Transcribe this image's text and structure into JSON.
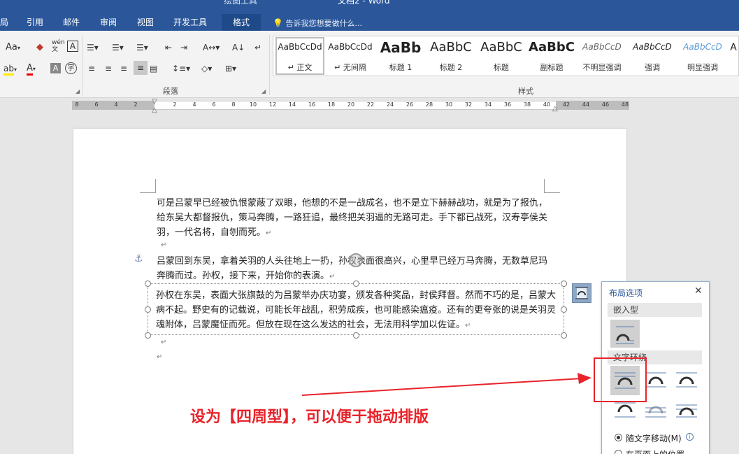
{
  "titlebar": {
    "context_tools": "绘图工具",
    "doc_title": "文档2 - Word",
    "tabs": [
      "局",
      "引用",
      "邮件",
      "审阅",
      "视图",
      "开发工具"
    ],
    "active_tab": "格式",
    "tell_me": "告诉我您想要做什么..."
  },
  "ribbon": {
    "font_case": "Aa",
    "wen": "wén",
    "group_paragraph": "段落",
    "group_styles": "样式",
    "styles": [
      {
        "sample": "AaBbCcDd",
        "name": "↵ 正文",
        "selected": true
      },
      {
        "sample": "AaBbCcDd",
        "name": "↵ 无间隔",
        "selected": false
      },
      {
        "sample": "AaBb",
        "name": "标题 1",
        "selected": false
      },
      {
        "sample": "AaBbC",
        "name": "标题 2",
        "selected": false
      },
      {
        "sample": "AaBbC",
        "name": "标题",
        "selected": false
      },
      {
        "sample": "AaBbC",
        "name": "副标题",
        "selected": false
      },
      {
        "sample": "AaBbCcD",
        "name": "不明显强调",
        "selected": false
      },
      {
        "sample": "AaBbCcD",
        "name": "强调",
        "selected": false
      },
      {
        "sample": "AaBbCcD",
        "name": "明显强调",
        "selected": false
      },
      {
        "sample": "A",
        "name": "",
        "selected": false
      }
    ]
  },
  "ruler": {
    "labels_left": [
      "8",
      "6",
      "4",
      "2"
    ],
    "labels_right": [
      "2",
      "4",
      "6",
      "8",
      "10",
      "12",
      "14",
      "16",
      "18",
      "20",
      "22",
      "24",
      "26",
      "28",
      "30",
      "32",
      "34",
      "36",
      "38",
      "40",
      "42",
      "44",
      "46",
      "48"
    ]
  },
  "document": {
    "para1": "可是吕蒙早已经被仇恨蒙蔽了双眼，他想的不是一战成名，也不是立下赫赫战功，就是为了报仇，给东吴大都督报仇，策马奔腾，一路狂追，最终把关羽逼的无路可走。手下都已战死，汉寿亭侯关羽，一代名将，自刎而死。",
    "para2": "吕蒙回到东吴，拿着关羽的人头往地上一扔，孙权表面很高兴，心里早已经万马奔腾，无数草尼玛奔腾而过。孙权，接下来，开始你的表演。",
    "para3": "孙权在东吴，表面大张旗鼓的为吕蒙举办庆功宴，颁发各种奖品，封侯拜督。然而不巧的是，吕蒙大病不起。野史有的记载说，可能长年战乱，积劳成疾，也可能感染瘟疫。还有的更夸张的说是关羽灵魂附体，吕蒙魔怔而死。但放在现在这么发达的社会，无法用科学加以佐证。",
    "para_mark": "↵"
  },
  "layout_panel": {
    "title": "布局选项",
    "close": "✕",
    "section_inline": "嵌入型",
    "section_wrap": "文字环绕",
    "move_with_text": "随文字移动(M)",
    "fix_on_page": "在页面上的位置"
  },
  "annotation": "设为【四周型】，可以便于拖动排版",
  "colors": {
    "titlebar": "#2b579a",
    "annotation": "#e8232a",
    "panel_border": "#9bb0cc"
  }
}
